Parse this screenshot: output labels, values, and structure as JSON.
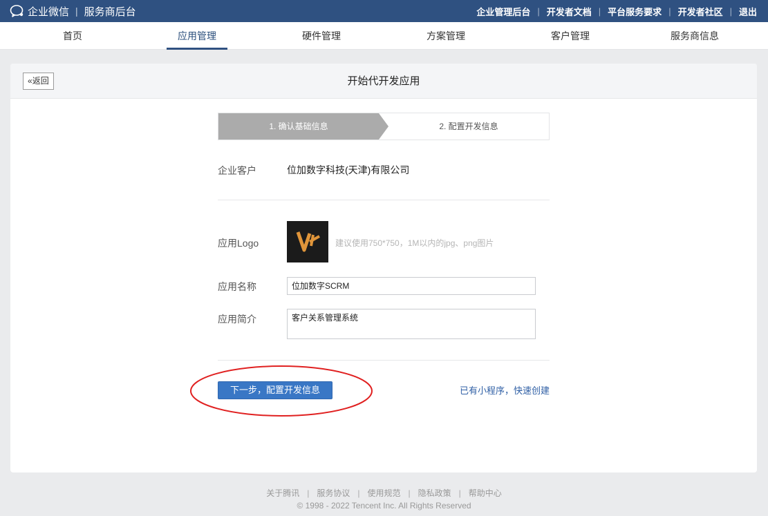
{
  "topbar": {
    "brand": "企业微信",
    "subtitle": "服务商后台",
    "links": [
      "企业管理后台",
      "开发者文档",
      "平台服务要求",
      "开发者社区",
      "退出"
    ]
  },
  "nav": {
    "tabs": [
      "首页",
      "应用管理",
      "硬件管理",
      "方案管理",
      "客户管理",
      "服务商信息"
    ],
    "active": "应用管理"
  },
  "page": {
    "back_label": "返回",
    "title": "开始代开发应用"
  },
  "steps": {
    "step1": "1. 确认基础信息",
    "step2": "2. 配置开发信息"
  },
  "form": {
    "customer_label": "企业客户",
    "customer_value": "位加数字科技(天津)有限公司",
    "logo_label": "应用Logo",
    "logo_hint": "建议使用750*750，1M以内的jpg、png图片",
    "name_label": "应用名称",
    "name_value": "位加数字SCRM",
    "desc_label": "应用简介",
    "desc_value": "客户关系管理系统"
  },
  "actions": {
    "next_label": "下一步，配置开发信息",
    "miniprogram_link": "已有小程序，快速创建"
  },
  "footer": {
    "links": [
      "关于腾讯",
      "服务协议",
      "使用规范",
      "隐私政策",
      "帮助中心"
    ],
    "copyright": "© 1998 - 2022 Tencent Inc. All Rights Reserved"
  },
  "colors": {
    "topbar": "#2f5181",
    "primary_button": "#3977c5",
    "step_active": "#ababab",
    "annotation": "#e02020"
  }
}
